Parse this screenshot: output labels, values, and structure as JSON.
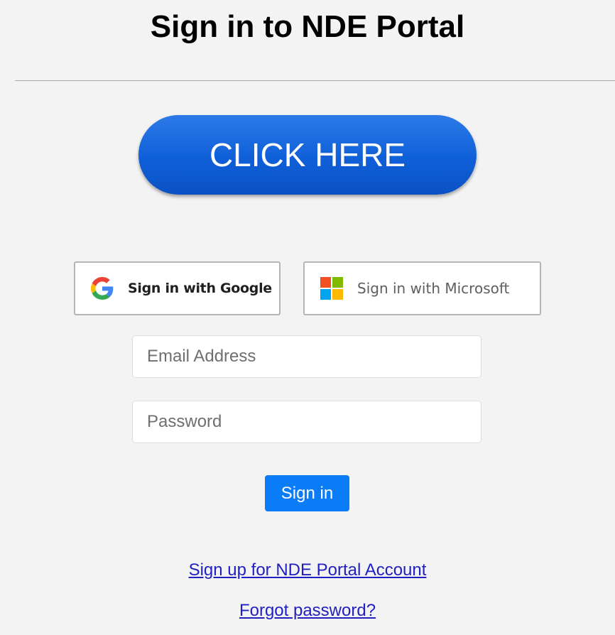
{
  "header": {
    "title": "Sign in to NDE Portal"
  },
  "promo": {
    "cta_label": "CLICK HERE"
  },
  "oauth": {
    "google_label": "Sign in with Google",
    "google_icon": "google-g-icon",
    "microsoft_label": "Sign in with Microsoft",
    "microsoft_icon": "microsoft-logo-icon"
  },
  "form": {
    "email": {
      "value": "",
      "placeholder": "Email Address"
    },
    "password": {
      "value": "",
      "placeholder": "Password"
    },
    "submit_label": "Sign in"
  },
  "links": {
    "signup": "Sign up for NDE Portal Account",
    "forgot": "Forgot password?"
  },
  "colors": {
    "page_background": "#f4f3f4",
    "cta_blue": "#0f5fd8",
    "submit_blue": "#0a7cf5",
    "link_blue": "#1f1fc2",
    "google_blue": "#4285F4",
    "google_red": "#EA4335",
    "google_yellow": "#FBBC05",
    "google_green": "#34A853",
    "ms_red": "#F25022",
    "ms_green": "#7FBA00",
    "ms_blue": "#00A4EF",
    "ms_yellow": "#FFB900"
  }
}
